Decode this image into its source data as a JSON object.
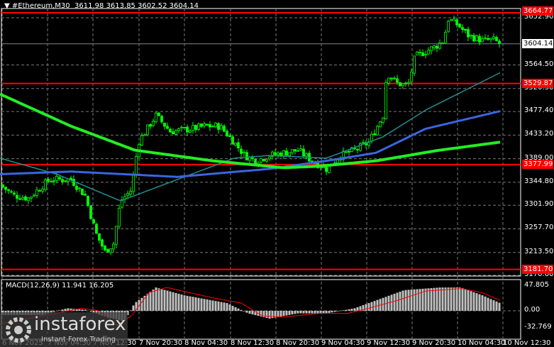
{
  "header": {
    "symbol": "#Ethereum,M30",
    "open": "3611.98",
    "high": "3613.85",
    "low": "3602.52",
    "close": "3604.14"
  },
  "price_axis": {
    "ticks": [
      "3652.90",
      "3564.50",
      "3520.30",
      "3477.40",
      "3433.20",
      "3389.00",
      "3344.80",
      "3301.90",
      "3257.70",
      "3213.50",
      "3170.60"
    ],
    "tick_values": [
      3652.9,
      3564.5,
      3520.3,
      3477.4,
      3433.2,
      3389.0,
      3344.8,
      3301.9,
      3257.7,
      3213.5,
      3170.6
    ],
    "current_price": "3604.14"
  },
  "levels": [
    {
      "label": "3664.77",
      "value": 3664.77
    },
    {
      "label": "3529.87",
      "value": 3529.87
    },
    {
      "label": "3377.99",
      "value": 3377.99
    },
    {
      "label": "3181.70",
      "value": 3181.7
    }
  ],
  "macd": {
    "label": "MACD(12,26,9) 11.941 16.205",
    "ticks": [
      "47.805",
      "0.00",
      "-32.769"
    ]
  },
  "time_axis": [
    "6 Nov 2025",
    "7 Nov 04:30",
    "7 Nov 12:30",
    "7 Nov 20:30",
    "8 Nov 04:30",
    "8 Nov 12:30",
    "8 Nov 20:30",
    "9 Nov 04:30",
    "9 Nov 12:30",
    "9 Nov 20:30",
    "10 Nov 04:30",
    "10 Nov 12:30"
  ],
  "watermark": {
    "name": "instaforex",
    "tagline": "Instant Forex Trading"
  },
  "colors": {
    "up": "#00ff00",
    "level": "#ff0000",
    "ma_fast": "#1f8f8f",
    "ma_mid": "#3a66e0",
    "ma_slow": "#22ee22",
    "macd_hist": "#c0c0c0",
    "macd_signal": "#ff0000"
  },
  "price_path": [
    [
      0,
      3340
    ],
    [
      20,
      3320
    ],
    [
      40,
      3315
    ],
    [
      70,
      3350
    ],
    [
      100,
      3350
    ],
    [
      120,
      3320
    ],
    [
      135,
      3250
    ],
    [
      148,
      3215
    ],
    [
      160,
      3230
    ],
    [
      170,
      3310
    ],
    [
      185,
      3330
    ],
    [
      195,
      3420
    ],
    [
      210,
      3450
    ],
    [
      220,
      3470
    ],
    [
      240,
      3440
    ],
    [
      270,
      3445
    ],
    [
      290,
      3450
    ],
    [
      310,
      3450
    ],
    [
      330,
      3420
    ],
    [
      345,
      3395
    ],
    [
      360,
      3385
    ],
    [
      380,
      3395
    ],
    [
      400,
      3400
    ],
    [
      420,
      3405
    ],
    [
      440,
      3385
    ],
    [
      460,
      3370
    ],
    [
      480,
      3395
    ],
    [
      500,
      3405
    ],
    [
      520,
      3420
    ],
    [
      540,
      3470
    ],
    [
      545,
      3550
    ],
    [
      560,
      3530
    ],
    [
      575,
      3525
    ],
    [
      585,
      3580
    ],
    [
      600,
      3590
    ],
    [
      615,
      3600
    ],
    [
      625,
      3610
    ],
    [
      632,
      3650
    ],
    [
      645,
      3640
    ],
    [
      660,
      3620
    ],
    [
      680,
      3610
    ],
    [
      695,
      3612
    ],
    [
      705,
      3604
    ]
  ],
  "ma_fast_path": [
    [
      0,
      3390
    ],
    [
      80,
      3360
    ],
    [
      170,
      3310
    ],
    [
      250,
      3350
    ],
    [
      330,
      3390
    ],
    [
      380,
      3395
    ],
    [
      460,
      3390
    ],
    [
      540,
      3430
    ],
    [
      600,
      3480
    ],
    [
      705,
      3550
    ]
  ],
  "ma_mid_path": [
    [
      0,
      3360
    ],
    [
      100,
      3365
    ],
    [
      250,
      3355
    ],
    [
      380,
      3370
    ],
    [
      460,
      3385
    ],
    [
      530,
      3400
    ],
    [
      600,
      3445
    ],
    [
      705,
      3478
    ]
  ],
  "ma_slow_path": [
    [
      0,
      3510
    ],
    [
      100,
      3450
    ],
    [
      190,
      3405
    ],
    [
      300,
      3385
    ],
    [
      400,
      3372
    ],
    [
      450,
      3375
    ],
    [
      530,
      3385
    ],
    [
      620,
      3405
    ],
    [
      705,
      3420
    ]
  ],
  "macd_hist_path": [
    [
      0,
      -8
    ],
    [
      60,
      -8
    ],
    [
      95,
      5
    ],
    [
      120,
      2
    ],
    [
      150,
      -12
    ],
    [
      175,
      -20
    ],
    [
      190,
      15
    ],
    [
      220,
      45
    ],
    [
      260,
      30
    ],
    [
      320,
      15
    ],
    [
      350,
      -5
    ],
    [
      380,
      -15
    ],
    [
      420,
      -5
    ],
    [
      460,
      -5
    ],
    [
      500,
      5
    ],
    [
      540,
      25
    ],
    [
      570,
      40
    ],
    [
      620,
      45
    ],
    [
      650,
      45
    ],
    [
      680,
      30
    ],
    [
      705,
      15
    ]
  ],
  "macd_signal_path": [
    [
      0,
      -25
    ],
    [
      60,
      -10
    ],
    [
      115,
      5
    ],
    [
      140,
      0
    ],
    [
      165,
      -28
    ],
    [
      185,
      -10
    ],
    [
      210,
      35
    ],
    [
      235,
      45
    ],
    [
      300,
      25
    ],
    [
      340,
      15
    ],
    [
      370,
      -10
    ],
    [
      400,
      -12
    ],
    [
      450,
      -5
    ],
    [
      490,
      -5
    ],
    [
      520,
      5
    ],
    [
      560,
      20
    ],
    [
      600,
      38
    ],
    [
      650,
      43
    ],
    [
      680,
      35
    ],
    [
      705,
      20
    ]
  ]
}
